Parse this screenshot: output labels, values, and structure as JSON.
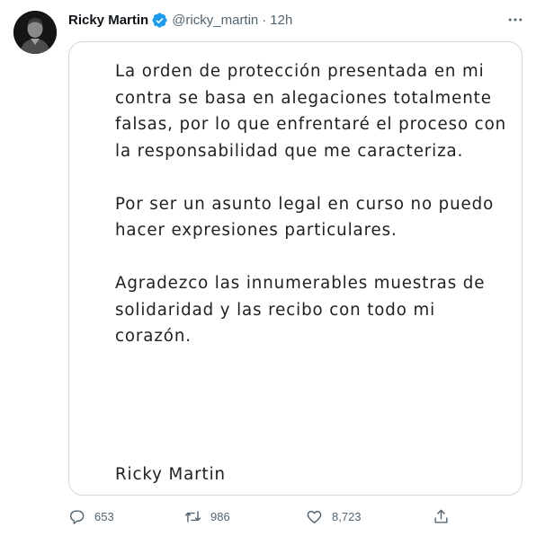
{
  "tweet": {
    "author": {
      "name": "Ricky Martin",
      "handle": "@ricky_martin",
      "verified": true,
      "avatar": "profile-photo"
    },
    "separator": "·",
    "time": "12h",
    "more_icon": "more-horizontal-icon",
    "media": {
      "paragraphs": [
        "La orden de protección presentada en mi contra se basa en alegaciones totalmente falsas, por lo que enfrentaré el proceso con la responsabilidad que me caracteriza.",
        "Por ser un asunto legal en curso no puedo hacer expresiones particulares.",
        "Agradezco las innumerables muestras de solidaridad y las recibo con todo mi corazón."
      ],
      "signature": "Ricky Martin"
    },
    "actions": {
      "reply": {
        "icon": "reply-icon",
        "count": "653"
      },
      "retweet": {
        "icon": "retweet-icon",
        "count": "986"
      },
      "like": {
        "icon": "like-icon",
        "count": "8,723"
      },
      "share": {
        "icon": "share-icon"
      }
    },
    "colors": {
      "verified_badge": "#1d9bf0",
      "secondary_text": "#536471",
      "border": "#cfd9de"
    }
  }
}
